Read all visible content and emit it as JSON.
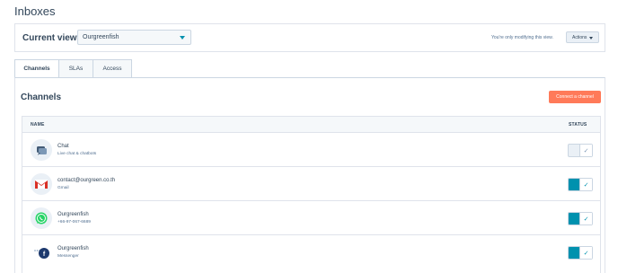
{
  "page": {
    "title": "Inboxes"
  },
  "view_bar": {
    "label": "Current view:",
    "selected_view": "Ourgreenfish",
    "note": "You're only modifying this view.",
    "actions_label": "Actions"
  },
  "tabs": [
    {
      "label": "Channels",
      "active": true
    },
    {
      "label": "SLAs",
      "active": false
    },
    {
      "label": "Access",
      "active": false
    }
  ],
  "channels": {
    "title": "Channels",
    "connect_label": "Connect a channel",
    "columns": {
      "name": "NAME",
      "status": "STATUS"
    },
    "rows": [
      {
        "name": "Chat",
        "sub": "Live chat & chatbots",
        "icon": "chat-bubble-icon",
        "enabled": false
      },
      {
        "name": "contact@ourgreen.co.th",
        "sub": "Gmail",
        "icon": "gmail-icon",
        "enabled": true
      },
      {
        "name": "Ourgreenfish",
        "sub": "+66-97-067-6689",
        "icon": "whatsapp-icon",
        "enabled": true
      },
      {
        "name": "Ourgreenfish",
        "sub": "Messenger",
        "icon": "facebook-messenger-icon",
        "enabled": true
      }
    ]
  },
  "colors": {
    "accent": "#0091ae",
    "primary_button": "#ff7a59",
    "text": "#33475b",
    "border": "#dfe3eb"
  }
}
